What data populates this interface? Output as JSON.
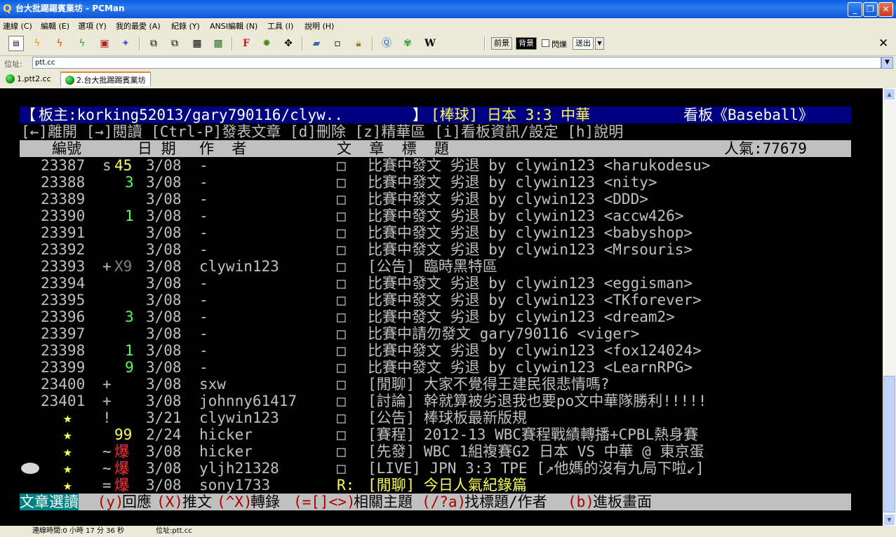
{
  "window": {
    "title": "台大批踢踢賓業坊 - PCMan"
  },
  "menu": [
    "連線 (C)",
    "編輯 (E)",
    "選項 (Y)",
    "我的最愛 (A)",
    "紀錄 (Y)",
    "ANSI編輯 (N)",
    "工具 (I)",
    "說明 (H)"
  ],
  "toolbar": {
    "fg_label": "前景",
    "bg_label": "背景",
    "blink_label": "閃爍",
    "send_label": "送出",
    "wiki_label": "W",
    "font_label": "F"
  },
  "address": {
    "label": "位址:",
    "value": "ptt.cc"
  },
  "tabs": [
    {
      "label": "1.ptt2.cc",
      "active": false
    },
    {
      "label": "2.台大批踢踢賓業坊",
      "active": true
    }
  ],
  "terminal": {
    "header1": {
      "bracket_l": "【",
      "moderators": "板主:korking52013/gary790116/clyw..",
      "bracket_r": "】",
      "topic": "[棒球] 日本 3:3 中華",
      "board": "看板《Baseball》"
    },
    "header2": "[←]離開 [→]閱讀 [Ctrl-P]發表文章 [d]刪除 [z]精華區 [i]看板資訊/設定 [h]說明",
    "columns": {
      "num": "編號",
      "date": "日 期",
      "author": "作  者",
      "title": "文  章  標  題",
      "popularity": "人氣:77679"
    },
    "rows": [
      {
        "num": "23387",
        "mark": "s",
        "push": "45",
        "pc": "#ffff55",
        "date": "3/08",
        "author": "-",
        "box": "□",
        "title": "比賽中發文 劣退 by clywin123 <harukodesu>",
        "tc": "#c0c0c0"
      },
      {
        "num": "23388",
        "mark": "",
        "push": "3",
        "pc": "#55ff55",
        "date": "3/08",
        "author": "-",
        "box": "□",
        "title": "比賽中發文 劣退 by clywin123 <nity>",
        "tc": "#c0c0c0"
      },
      {
        "num": "23389",
        "mark": "",
        "push": "",
        "pc": "#c0c0c0",
        "date": "3/08",
        "author": "-",
        "box": "□",
        "title": "比賽中發文 劣退 by clywin123 <DDD>",
        "tc": "#c0c0c0"
      },
      {
        "num": "23390",
        "mark": "",
        "push": "1",
        "pc": "#55ff55",
        "date": "3/08",
        "author": "-",
        "box": "□",
        "title": "比賽中發文 劣退 by clywin123 <accw426>",
        "tc": "#c0c0c0"
      },
      {
        "num": "23391",
        "mark": "",
        "push": "",
        "pc": "#c0c0c0",
        "date": "3/08",
        "author": "-",
        "box": "□",
        "title": "比賽中發文 劣退 by clywin123 <babyshop>",
        "tc": "#c0c0c0"
      },
      {
        "num": "23392",
        "mark": "",
        "push": "",
        "pc": "#c0c0c0",
        "date": "3/08",
        "author": "-",
        "box": "□",
        "title": "比賽中發文 劣退 by clywin123 <Mrsouris>",
        "tc": "#c0c0c0"
      },
      {
        "num": "23393",
        "mark": "+",
        "push": "X9",
        "pc": "#808080",
        "date": "3/08",
        "author": "clywin123",
        "box": "□",
        "title": "[公告] 臨時黑特區",
        "tc": "#c0c0c0"
      },
      {
        "num": "23394",
        "mark": "",
        "push": "",
        "pc": "#c0c0c0",
        "date": "3/08",
        "author": "-",
        "box": "□",
        "title": "比賽中發文 劣退 by clywin123 <eggisman>",
        "tc": "#c0c0c0"
      },
      {
        "num": "23395",
        "mark": "",
        "push": "",
        "pc": "#c0c0c0",
        "date": "3/08",
        "author": "-",
        "box": "□",
        "title": "比賽中發文 劣退 by clywin123 <TKforever>",
        "tc": "#c0c0c0"
      },
      {
        "num": "23396",
        "mark": "",
        "push": "3",
        "pc": "#55ff55",
        "date": "3/08",
        "author": "-",
        "box": "□",
        "title": "比賽中發文 劣退 by clywin123 <dream2>",
        "tc": "#c0c0c0"
      },
      {
        "num": "23397",
        "mark": "",
        "push": "",
        "pc": "#c0c0c0",
        "date": "3/08",
        "author": "-",
        "box": "□",
        "title": "比賽中請勿發文 gary790116 <viger>",
        "tc": "#c0c0c0"
      },
      {
        "num": "23398",
        "mark": "",
        "push": "1",
        "pc": "#55ff55",
        "date": "3/08",
        "author": "-",
        "box": "□",
        "title": "比賽中發文 劣退 by clywin123 <fox124024>",
        "tc": "#c0c0c0"
      },
      {
        "num": "23399",
        "mark": "",
        "push": "9",
        "pc": "#55ff55",
        "date": "3/08",
        "author": "-",
        "box": "□",
        "title": "比賽中發文 劣退 by clywin123 <LearnRPG>",
        "tc": "#c0c0c0"
      },
      {
        "num": "23400",
        "mark": "+",
        "push": "",
        "pc": "#c0c0c0",
        "date": "3/08",
        "author": "sxw",
        "box": "□",
        "title": "[閒聊] 大家不覺得王建民很悲情嗎?",
        "tc": "#c0c0c0"
      },
      {
        "num": "23401",
        "mark": "+",
        "push": "",
        "pc": "#c0c0c0",
        "date": "3/08",
        "author": "johnny61417",
        "box": "□",
        "title": "[討論] 幹就算被劣退我也要po文中華隊勝利!!!!!",
        "tc": "#c0c0c0"
      },
      {
        "num": "★",
        "mark": "!",
        "push": "",
        "pc": "#c0c0c0",
        "date": "3/21",
        "author": "clywin123",
        "box": "□",
        "title": "[公告] 棒球板最新版規",
        "tc": "#c0c0c0"
      },
      {
        "num": "★",
        "mark": "",
        "push": "99",
        "pc": "#ffff55",
        "date": "2/24",
        "author": "hicker",
        "box": "□",
        "title": "[賽程] 2012-13 WBC賽程戰績轉播+CPBL熱身賽",
        "tc": "#c0c0c0"
      },
      {
        "num": "★",
        "mark": "~",
        "push": "爆",
        "pc": "#ff3333",
        "date": "3/08",
        "author": "hicker",
        "box": "□",
        "title": "[先發] WBC 1組複賽G2 日本 VS 中華 @ 東京蛋",
        "tc": "#c0c0c0"
      },
      {
        "num": "★",
        "mark": "~",
        "push": "爆",
        "pc": "#ff3333",
        "date": "3/08",
        "author": "yljh21328",
        "box": "□",
        "title": "[LIVE] JPN 3:3 TPE [↗他媽的沒有九局下啦↙]",
        "tc": "#c0c0c0"
      },
      {
        "num": "★",
        "mark": "=",
        "push": "爆",
        "pc": "#ff3333",
        "date": "3/08",
        "author": "sony1733",
        "box": "R:",
        "title": "[閒聊] 今日人氣紀錄篇",
        "tc": "#ffff55"
      }
    ],
    "footer": {
      "mode": "文章選讀",
      "p1": " (y)",
      "p2": "回應",
      "p3": "(X)",
      "p4": "推文",
      "p5": "(^X)",
      "p6": "轉錄 ",
      "p7": "(=[]<>)",
      "p8": "相關主題",
      "p9": "(/?a)",
      "p10": "找標題/作者 ",
      "p11": "(b)",
      "p12": "進板畫面"
    }
  },
  "status": {
    "time": "連線時間:0 小時 17 分 36 秒",
    "addr": "位址:ptt.cc"
  }
}
